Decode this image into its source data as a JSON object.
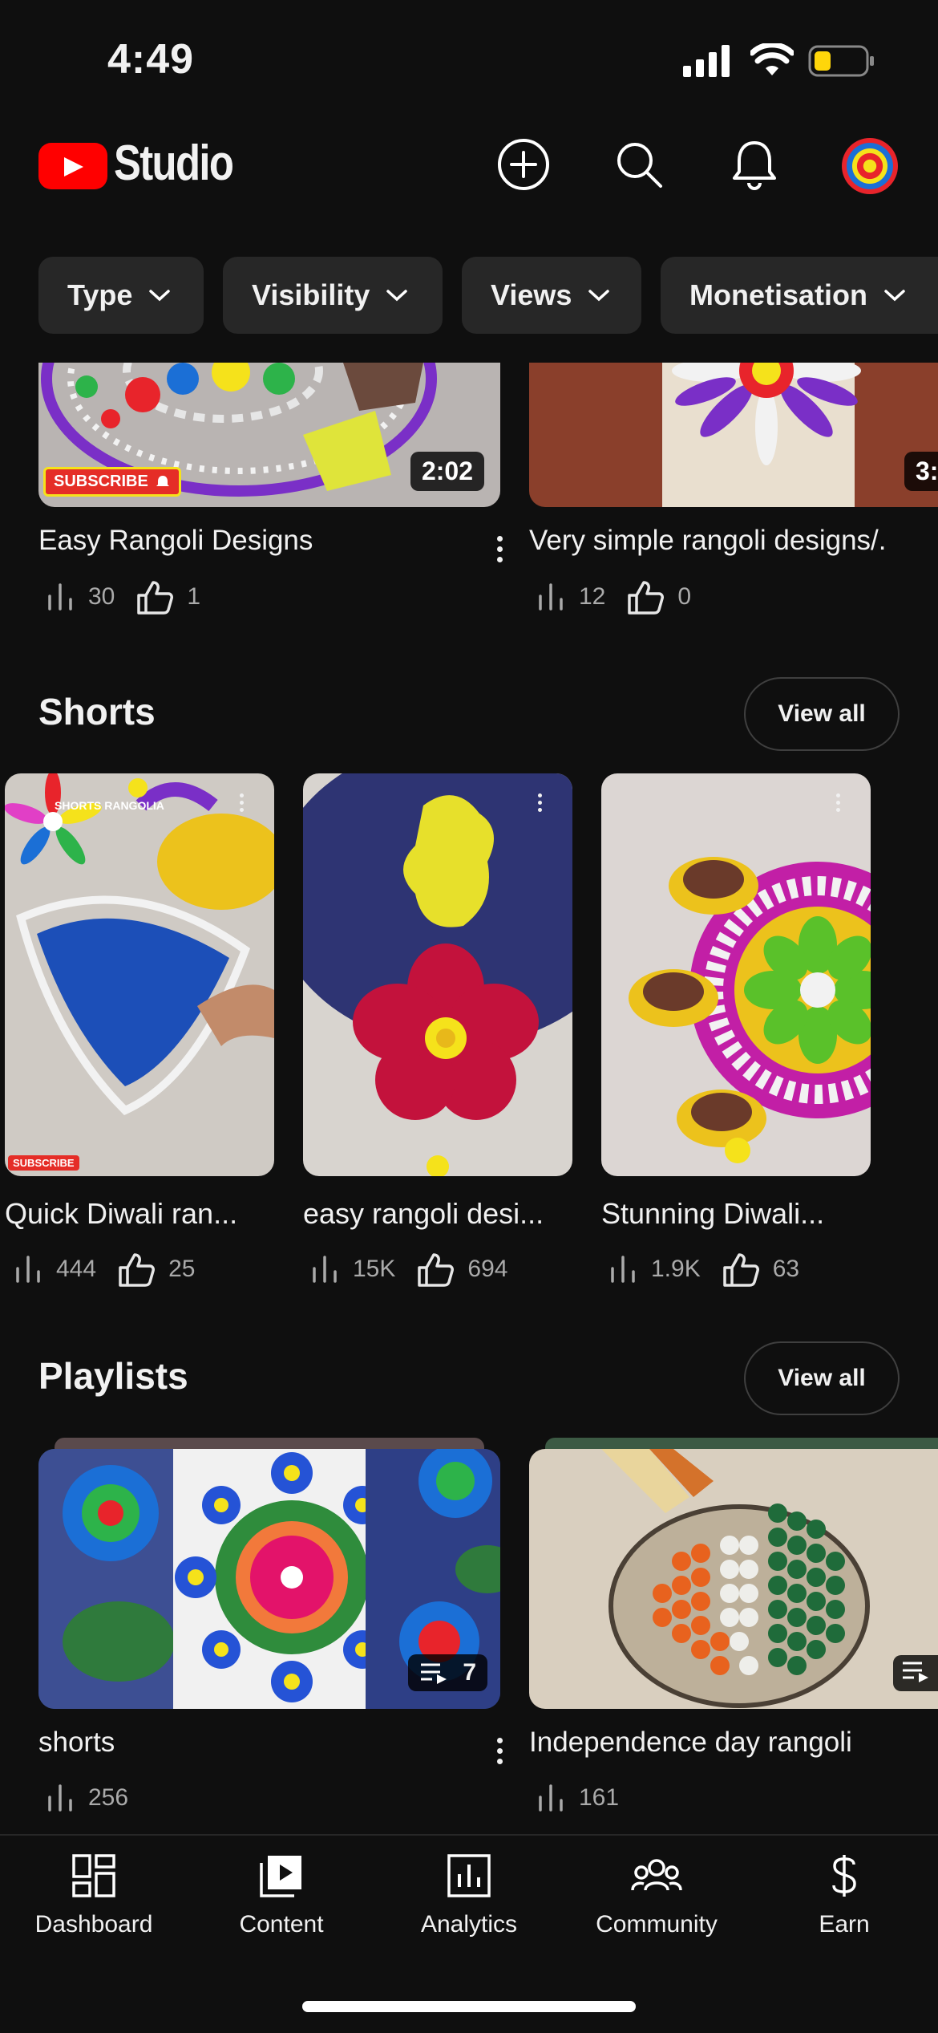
{
  "status": {
    "time": "4:49"
  },
  "header": {
    "brand": "Studio"
  },
  "filters": [
    {
      "label": "Type"
    },
    {
      "label": "Visibility"
    },
    {
      "label": "Views"
    },
    {
      "label": "Monetisation"
    }
  ],
  "videos": [
    {
      "title": "Easy Rangoli Designs",
      "duration": "2:02",
      "views": "30",
      "likes": "1",
      "badge": "SUBSCRIBE"
    },
    {
      "title": "Very simple rangoli designs/.",
      "duration": "3:",
      "views": "12",
      "likes": "0"
    }
  ],
  "shorts": {
    "title": "Shorts",
    "view_all": "View all",
    "items": [
      {
        "title": "Quick Diwali ran...",
        "views": "444",
        "likes": "25",
        "overlay": "SHORTS RANGOLIA",
        "badge": "SUBSCRIBE"
      },
      {
        "title": "easy rangoli desi...",
        "views": "15K",
        "likes": "694"
      },
      {
        "title": "Stunning Diwali...",
        "views": "1.9K",
        "likes": "63"
      }
    ]
  },
  "playlists": {
    "title": "Playlists",
    "view_all": "View all",
    "items": [
      {
        "title": "shorts",
        "count": "7",
        "views": "256"
      },
      {
        "title": "Independence day rangoli",
        "views": "161"
      }
    ]
  },
  "nav": [
    {
      "label": "Dashboard",
      "icon": "dashboard-icon"
    },
    {
      "label": "Content",
      "icon": "content-icon"
    },
    {
      "label": "Analytics",
      "icon": "analytics-icon"
    },
    {
      "label": "Community",
      "icon": "community-icon"
    },
    {
      "label": "Earn",
      "icon": "earn-icon"
    }
  ],
  "colors": {
    "background": "#0f0f0f",
    "chip": "#272727",
    "brand": "#ff0000",
    "secondary_text": "#aaaaaa"
  }
}
